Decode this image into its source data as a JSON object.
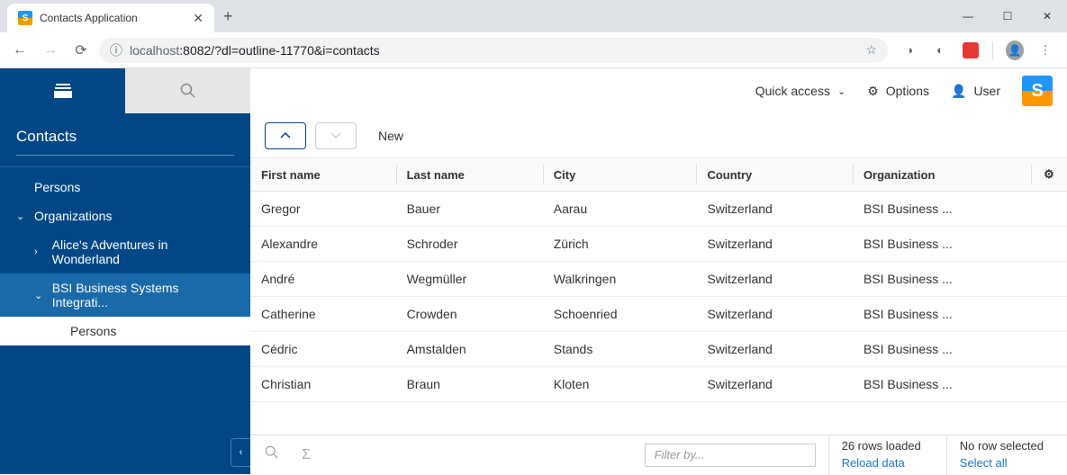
{
  "browser": {
    "tab_title": "Contacts Application",
    "url_host": "localhost",
    "url_path": ":8082/?dl=outline-11770&i=contacts"
  },
  "sidebar": {
    "title": "Contacts",
    "items": {
      "persons": "Persons",
      "organizations": "Organizations",
      "alice": "Alice's Adventures in Wonderland",
      "bsi": "BSI Business Systems Integrati...",
      "bsi_persons": "Persons"
    }
  },
  "topbar": {
    "quick_access": "Quick access",
    "options": "Options",
    "user": "User"
  },
  "toolbar": {
    "new_label": "New"
  },
  "table": {
    "headers": {
      "first_name": "First name",
      "last_name": "Last name",
      "city": "City",
      "country": "Country",
      "organization": "Organization"
    },
    "rows": [
      {
        "first": "Gregor",
        "last": "Bauer",
        "city": "Aarau",
        "country": "Switzerland",
        "org": "BSI Business ..."
      },
      {
        "first": "Alexandre",
        "last": "Schroder",
        "city": "Zürich",
        "country": "Switzerland",
        "org": "BSI Business ..."
      },
      {
        "first": "André",
        "last": "Wegmüller",
        "city": "Walkringen",
        "country": "Switzerland",
        "org": "BSI Business ..."
      },
      {
        "first": "Catherine",
        "last": "Crowden",
        "city": "Schoenried",
        "country": "Switzerland",
        "org": "BSI Business ..."
      },
      {
        "first": "Cédric",
        "last": "Amstalden",
        "city": "Stands",
        "country": "Switzerland",
        "org": "BSI Business ..."
      },
      {
        "first": "Christian",
        "last": "Braun",
        "city": "Kloten",
        "country": "Switzerland",
        "org": "BSI Business ..."
      }
    ]
  },
  "statusbar": {
    "filter_placeholder": "Filter by...",
    "rows_loaded": "26 rows loaded",
    "reload": "Reload data",
    "selection": "No row selected",
    "select_all": "Select all"
  }
}
